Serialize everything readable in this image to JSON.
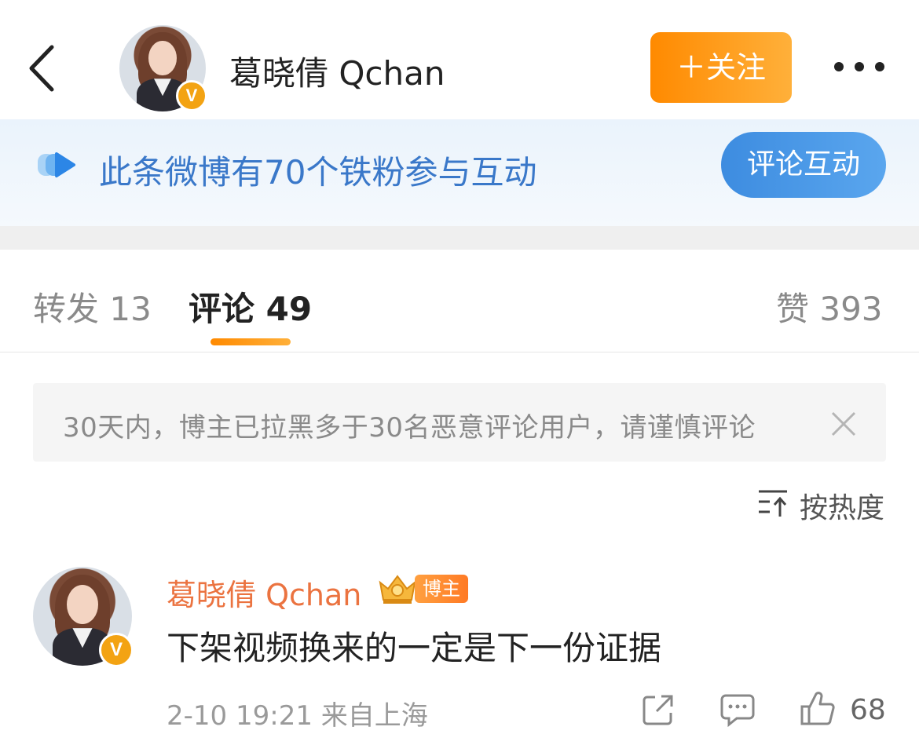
{
  "header": {
    "back_icon": "chevron-left-icon",
    "user_name": "葛晓倩 Qchan",
    "verified_mark": "V",
    "follow_label": "＋关注",
    "more_icon": "more-dots-icon"
  },
  "banner": {
    "text": "此条微博有70个铁粉参与互动",
    "button_label": "评论互动",
    "icon": "play-badge-icon"
  },
  "tabs": {
    "repost": "转发 13",
    "comment": "评论 49",
    "like": "赞 393"
  },
  "notice": {
    "text": "30天内，博主已拉黑多于30名恶意评论用户，请谨慎评论",
    "close_icon": "close-icon"
  },
  "sort": {
    "label": "按热度",
    "icon": "sort-icon"
  },
  "comment": {
    "user_name": "葛晓倩 Qchan",
    "badge": "博主",
    "verified_mark": "V",
    "text": "下架视频换来的一定是下一份证据",
    "meta": "2-10 19:21 来自上海",
    "like_count": "68"
  },
  "colors": {
    "accent_orange": "#ff8a00",
    "link_blue": "#3a78c9",
    "name_orange": "#eb7340"
  }
}
